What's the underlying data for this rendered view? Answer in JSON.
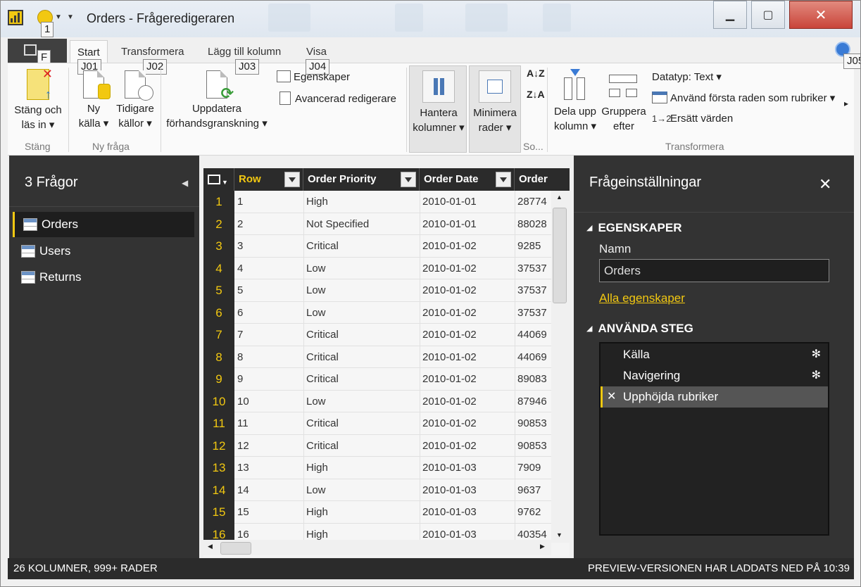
{
  "window": {
    "title": "Orders - Frågeredigeraren",
    "keytips": {
      "qa": "1",
      "file": "F",
      "start": "J01",
      "transform": "J02",
      "add_column": "J03",
      "view": "J04",
      "help": "J05"
    }
  },
  "tabs": [
    "Start",
    "Transformera",
    "Lägg till kolumn",
    "Visa"
  ],
  "ribbon": {
    "close_load": [
      "Stäng och",
      "läs in ▾"
    ],
    "new_source": [
      "Ny",
      "källa ▾"
    ],
    "recent_sources": [
      "Tidigare",
      "källor ▾"
    ],
    "refresh_preview": [
      "Uppdatera",
      "förhandsgranskning ▾"
    ],
    "properties": "Egenskaper",
    "advanced_editor": "Avancerad redigerare",
    "manage_columns": [
      "Hantera",
      "kolumner ▾"
    ],
    "reduce_rows": [
      "Minimera",
      "rader ▾"
    ],
    "split_column": [
      "Dela upp",
      "kolumn ▾"
    ],
    "group_by": [
      "Gruppera",
      "efter"
    ],
    "datatype": "Datatyp: Text ▾",
    "first_row_headers": "Använd första raden som rubriker ▾",
    "replace_values": "Ersätt värden",
    "groups": {
      "close": "Stäng",
      "new_query": "Ny fråga",
      "sort": "So...",
      "transform": "Transformera"
    }
  },
  "queries": {
    "title": "3 Frågor",
    "items": [
      "Orders",
      "Users",
      "Returns"
    ],
    "selected": "Orders"
  },
  "grid": {
    "columns": [
      "Row",
      "Order Priority",
      "Order Date",
      "Order"
    ],
    "rows": [
      [
        "1",
        "High",
        "2010-01-01",
        "28774"
      ],
      [
        "2",
        "Not Specified",
        "2010-01-01",
        "88028"
      ],
      [
        "3",
        "Critical",
        "2010-01-02",
        "9285"
      ],
      [
        "4",
        "Low",
        "2010-01-02",
        "37537"
      ],
      [
        "5",
        "Low",
        "2010-01-02",
        "37537"
      ],
      [
        "6",
        "Low",
        "2010-01-02",
        "37537"
      ],
      [
        "7",
        "Critical",
        "2010-01-02",
        "44069"
      ],
      [
        "8",
        "Critical",
        "2010-01-02",
        "44069"
      ],
      [
        "9",
        "Critical",
        "2010-01-02",
        "89083"
      ],
      [
        "10",
        "Low",
        "2010-01-02",
        "87946"
      ],
      [
        "11",
        "Critical",
        "2010-01-02",
        "90853"
      ],
      [
        "12",
        "Critical",
        "2010-01-02",
        "90853"
      ],
      [
        "13",
        "High",
        "2010-01-03",
        "7909"
      ],
      [
        "14",
        "Low",
        "2010-01-03",
        "9637"
      ],
      [
        "15",
        "High",
        "2010-01-03",
        "9762"
      ],
      [
        "16",
        "High",
        "2010-01-03",
        "40354"
      ]
    ]
  },
  "settings": {
    "title": "Frågeinställningar",
    "properties_header": "EGENSKAPER",
    "name_label": "Namn",
    "name_value": "Orders",
    "all_properties": "Alla egenskaper",
    "steps_header": "ANVÄNDA STEG",
    "steps": [
      "Källa",
      "Navigering",
      "Upphöjda rubriker"
    ],
    "selected_step": "Upphöjda rubriker"
  },
  "status": {
    "left": "26 KOLUMNER, 999+ RADER",
    "right": "PREVIEW-VERSIONEN HAR LADDATS NED PÅ 10:39"
  },
  "colors": {
    "accent": "#f2c811",
    "dark_pane": "#333333"
  }
}
